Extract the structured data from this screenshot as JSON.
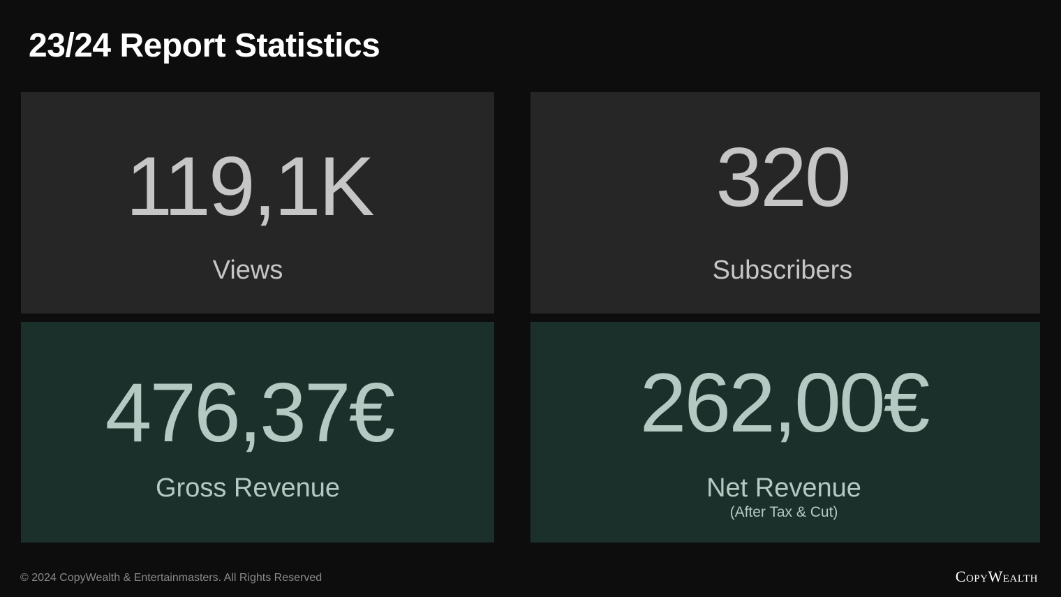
{
  "title": "23/24 Report Statistics",
  "stats": {
    "views": {
      "value": "119,1K",
      "label": "Views"
    },
    "subscribers": {
      "value": "320",
      "label": "Subscribers"
    },
    "gross_revenue": {
      "value": "476,37€",
      "label": "Gross Revenue"
    },
    "net_revenue": {
      "value": "262,00€",
      "label": "Net Revenue",
      "sublabel": "(After Tax & Cut)"
    }
  },
  "footer": {
    "copyright": "© 2024 CopyWealth & Entertainmasters. All Rights Reserved",
    "brand": "CopyWealth"
  },
  "colors": {
    "background": "#0d0d0d",
    "card_gray": "#262626",
    "card_green": "#1c302b",
    "text_gray": "#c6c6c6",
    "text_green": "#b3c9c1"
  }
}
